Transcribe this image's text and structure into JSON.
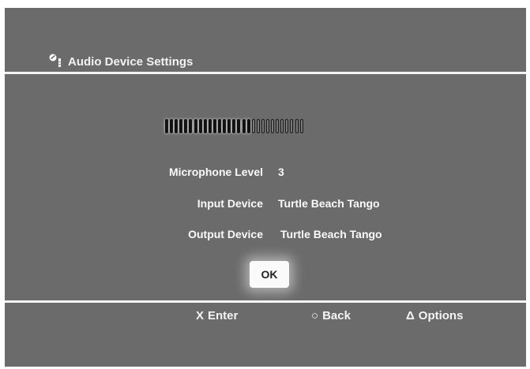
{
  "header": {
    "title": "Audio Device Settings",
    "icon": "mic-settings-icon"
  },
  "meter": {
    "level_fraction": 0.6207,
    "segments_total": 29,
    "segments_filled": 18
  },
  "settings": {
    "microphone_level_label": "Microphone Level",
    "microphone_level_value": "3",
    "input_device_label": "Input Device",
    "input_device_value": "Turtle Beach Tango",
    "output_device_label": "Output Device",
    "output_device_value": "Turtle Beach Tango"
  },
  "buttons": {
    "ok_label": "OK"
  },
  "footer": {
    "enter_glyph": "X",
    "enter_label": "Enter",
    "back_glyph": "○",
    "back_label": "Back",
    "options_glyph": "Δ",
    "options_label": "Options"
  },
  "colors": {
    "background": "#6b6b6b",
    "text": "#fafafa",
    "divider": "#f4f4f4"
  }
}
